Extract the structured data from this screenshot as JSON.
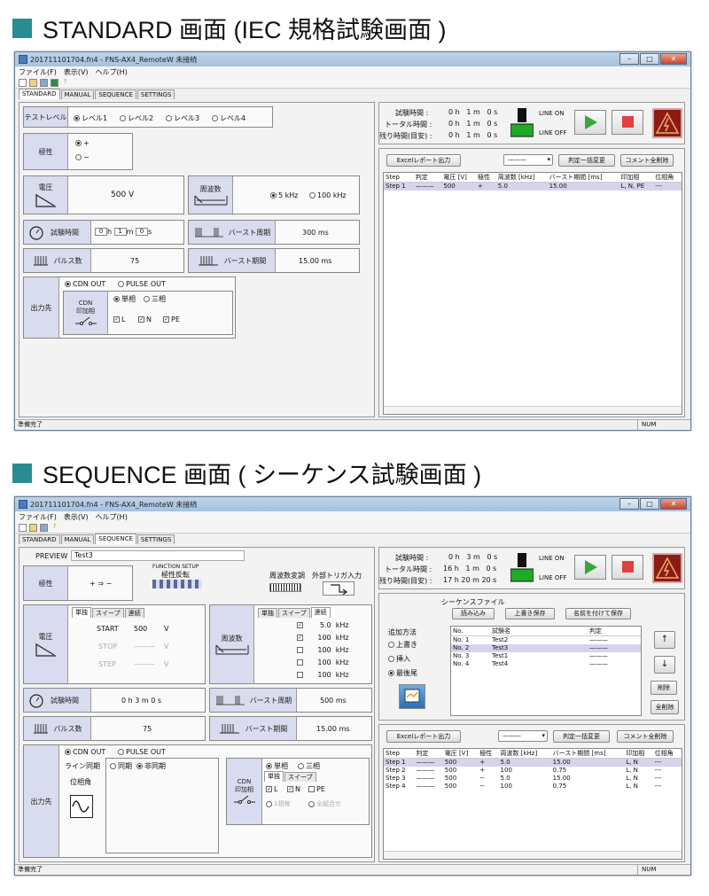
{
  "headings": {
    "top": "STANDARD 画面 (IEC 規格試験画面 )",
    "bottom": "SEQUENCE 画面 ( シーケンス試験画面 )"
  },
  "window": {
    "title": "201711101704.fn4 - FNS-AX4_RemoteW 未接続",
    "menu": [
      "ファイル(F)",
      "表示(V)",
      "ヘルプ(H)"
    ],
    "tabs": [
      "STANDARD",
      "MANUAL",
      "SEQUENCE",
      "SETTINGS"
    ],
    "status_left": "準備完了",
    "status_right": "NUM",
    "help_icon": "?"
  },
  "timer": {
    "test_time_label": "試験時間 :",
    "total_time_label": "トータル時間 :",
    "remaining_label": "残り時間(目安) :",
    "line_on": "LINE ON",
    "line_off": "LINE OFF",
    "unit_h": "h",
    "unit_m": "m",
    "unit_s": "s"
  },
  "standard": {
    "test_level_label": "テストレベル",
    "levels": [
      "レベル1",
      "レベル2",
      "レベル3",
      "レベル4"
    ],
    "polarity_label": "極性",
    "polarity_options": [
      "+",
      "−"
    ],
    "voltage_label": "電圧",
    "voltage_value": "500 V",
    "freq_label": "周波数",
    "freq_options": [
      "5 kHz",
      "100 kHz"
    ],
    "test_time_label": "試験時間",
    "time_h": "0",
    "time_m": "1",
    "time_s": "0",
    "time_unit_h": "h",
    "time_unit_m": "m",
    "time_unit_s": "s",
    "burst_period_label": "バースト周期",
    "burst_period_value": "300 ms",
    "pulse_count_label": "パルス数",
    "pulse_count_value": "75",
    "burst_duration_label": "バースト期間",
    "burst_duration_value": "15.00 ms",
    "output_label": "出力先",
    "output_options": [
      "CDN OUT",
      "PULSE OUT"
    ],
    "cdn_label_1": "CDN",
    "cdn_label_2": "印加相",
    "phase_options": [
      "単相",
      "三相"
    ],
    "lines": [
      "L",
      "N",
      "PE"
    ],
    "timer": {
      "t_h": "0",
      "t_m": "1",
      "t_s": "0",
      "tt_h": "0",
      "tt_m": "1",
      "tt_s": "0",
      "r_h": "0",
      "r_m": "1",
      "r_s": "0"
    },
    "excel_btn": "Excelレポート出力",
    "dropdown_value": "———",
    "judge_btn": "判定一括変更",
    "clear_btn": "コメント全削除",
    "grid_headers": [
      "Step",
      "判定",
      "電圧 [V]",
      "極性",
      "周波数 [kHz]",
      "バースト期間 [ms]",
      "印加相",
      "位相角"
    ],
    "grid_rows": [
      [
        "Step  1",
        "———",
        "500",
        "+",
        "5.0",
        "15.00",
        "L, N, PE",
        "---"
      ]
    ]
  },
  "sequence": {
    "preview_label": "PREVIEW",
    "preview_value": "Test3",
    "function_setup": "FUNCTION SETUP",
    "polarity_flip": "極性反転",
    "freq_mod": "周波数変調",
    "ext_trigger": "外部トリガ入力",
    "polarity_label": "極性",
    "polarity_value": "+ ⇒ −",
    "voltage_label": "電圧",
    "sub_tabs": [
      "単独",
      "スイープ",
      "連続"
    ],
    "start_label": "START",
    "start_value": "500",
    "stop_label": "STOP",
    "stop_value": "———",
    "step_label": "STEP",
    "step_value": "———",
    "unit_v": "V",
    "freq_label": "周波数",
    "freq_values": [
      "5.0",
      "100",
      "100",
      "100",
      "100"
    ],
    "freq_unit": "kHz",
    "test_time_label": "試験時間",
    "test_time_value": "0 h  3 m  0 s",
    "burst_period_label": "バースト周期",
    "burst_period_value": "500 ms",
    "pulse_count_label": "パルス数",
    "pulse_count_value": "75",
    "burst_duration_label": "バースト期間",
    "burst_duration_value": "15.00 ms",
    "output_label": "出力先",
    "output_options": [
      "CDN OUT",
      "PULSE OUT"
    ],
    "line_sync_label": "ライン同期",
    "sync_options": [
      "同期",
      "非同期"
    ],
    "phase_angle_label": "位相角",
    "cdn_label_1": "CDN",
    "cdn_label_2": "印加相",
    "phase_options": [
      "単相",
      "三相"
    ],
    "cdn_tabs": [
      "単独",
      "スイープ"
    ],
    "lines": [
      "L",
      "N",
      "PE"
    ],
    "combo_options": [
      "1相毎",
      "全組合せ"
    ],
    "timer": {
      "t_h": "0",
      "t_m": "3",
      "t_s": "0",
      "tt_h": "16",
      "tt_m": "1",
      "tt_s": "0",
      "r_h": "17",
      "r_m": "20",
      "r_s": "20"
    },
    "seq_file_label": "シーケンスファイル",
    "load_btn": "読み込み",
    "overwrite_btn": "上書き保存",
    "saveas_btn": "名前を付けて保存",
    "add_method_label": "追加方法",
    "add_options": [
      "上書き",
      "挿入",
      "最後尾"
    ],
    "seq_headers": [
      "No.",
      "試験名",
      "判定"
    ],
    "seq_rows": [
      [
        "No.  1",
        "Test2",
        "———"
      ],
      [
        "No.  2",
        "Test3",
        "———"
      ],
      [
        "No.  3",
        "Test1",
        "———"
      ],
      [
        "No.  4",
        "Test4",
        "———"
      ]
    ],
    "up_btn": "↑",
    "down_btn": "↓",
    "delete_btn": "削除",
    "delete_all_btn": "全削除",
    "excel_btn": "Excelレポート出力",
    "dropdown_value": "———",
    "judge_btn": "判定一括変更",
    "clear_btn": "コメント全削除",
    "grid_headers": [
      "Step",
      "判定",
      "電圧 [V]",
      "極性",
      "周波数 [kHz]",
      "バースト期間 [ms]",
      "印加相",
      "位相角"
    ],
    "grid_rows": [
      [
        "Step  1",
        "———",
        "500",
        "+",
        "5.0",
        "15.00",
        "L, N",
        "---"
      ],
      [
        "Step  2",
        "———",
        "500",
        "+",
        "100",
        "0.75",
        "L, N",
        "---"
      ],
      [
        "Step  3",
        "———",
        "500",
        "−",
        "5.0",
        "15.00",
        "L, N",
        "---"
      ],
      [
        "Step  4",
        "———",
        "500",
        "−",
        "100",
        "0.75",
        "L, N",
        "---"
      ]
    ]
  },
  "colors": {
    "accent": "#2a8c93",
    "label_bg": "#d9dcee",
    "play": "#3aa63a",
    "stop": "#e04040",
    "warning": "#8e1a14"
  }
}
